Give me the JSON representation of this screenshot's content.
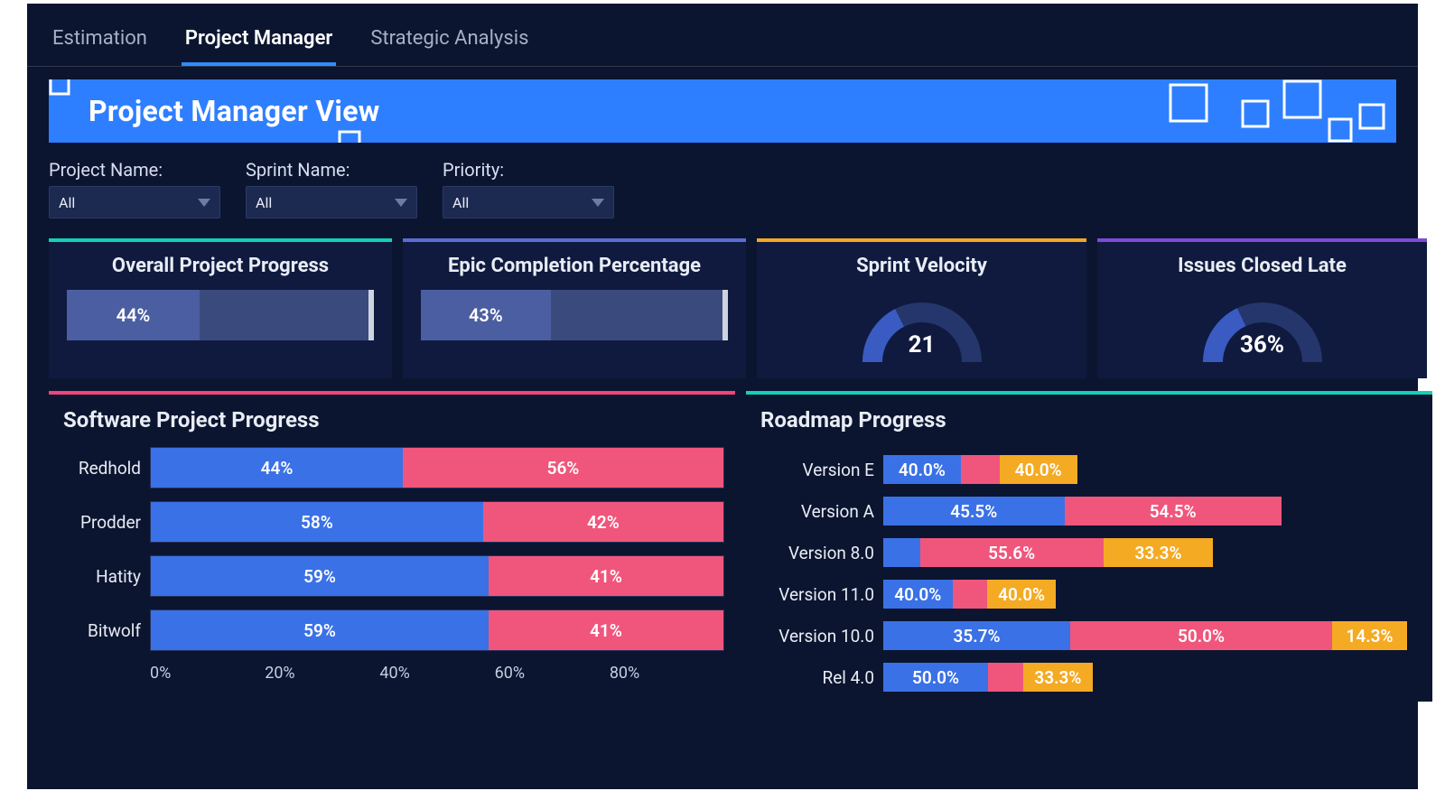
{
  "tabs": [
    {
      "label": "Estimation",
      "active": false
    },
    {
      "label": "Project Manager",
      "active": true
    },
    {
      "label": "Strategic Analysis",
      "active": false
    }
  ],
  "banner": {
    "title": "Project Manager View"
  },
  "filters": {
    "project": {
      "label": "Project Name:",
      "value": "All"
    },
    "sprint": {
      "label": "Sprint Name:",
      "value": "All"
    },
    "priority": {
      "label": "Priority:",
      "value": "All"
    }
  },
  "kpi": {
    "overall": {
      "title": "Overall Project Progress",
      "value": 44,
      "display": "44%"
    },
    "epic": {
      "title": "Epic Completion Percentage",
      "value": 43,
      "display": "43%"
    },
    "velocity": {
      "title": "Sprint Velocity",
      "value": 21,
      "display": "21"
    },
    "late": {
      "title": "Issues Closed Late",
      "value": 36,
      "display": "36%"
    }
  },
  "software": {
    "title": "Software Project Progress",
    "rows": [
      {
        "label": "Redhold",
        "blue": 44,
        "red": 56,
        "bd": "44%",
        "rd": "56%"
      },
      {
        "label": "Prodder",
        "blue": 58,
        "red": 42,
        "bd": "58%",
        "rd": "42%"
      },
      {
        "label": "Hatity",
        "blue": 59,
        "red": 41,
        "bd": "59%",
        "rd": "41%"
      },
      {
        "label": "Bitwolf",
        "blue": 59,
        "red": 41,
        "bd": "59%",
        "rd": "41%"
      }
    ],
    "xticks": [
      "0%",
      "20%",
      "40%",
      "60%",
      "80%"
    ]
  },
  "roadmap": {
    "title": "Roadmap Progress",
    "max": 100,
    "rows": [
      {
        "label": "Version E",
        "blue": 40.0,
        "red": 20.0,
        "yel": 40.0,
        "total_scale": 37,
        "bd": "40.0%",
        "rd": "",
        "yd": "40.0%"
      },
      {
        "label": "Version A",
        "blue": 45.5,
        "red": 54.5,
        "yel": 0,
        "total_scale": 76,
        "bd": "45.5%",
        "rd": "54.5%",
        "yd": ""
      },
      {
        "label": "Version 8.0",
        "blue": 11.1,
        "red": 55.6,
        "yel": 33.3,
        "total_scale": 63,
        "bd": "",
        "rd": "55.6%",
        "yd": "33.3%"
      },
      {
        "label": "Version 11.0",
        "blue": 40.0,
        "red": 20.0,
        "yel": 40.0,
        "total_scale": 33,
        "bd": "40.0%",
        "rd": "",
        "yd": "40.0%"
      },
      {
        "label": "Version 10.0",
        "blue": 35.7,
        "red": 50.0,
        "yel": 14.3,
        "total_scale": 100,
        "bd": "35.7%",
        "rd": "50.0%",
        "yd": "14.3%"
      },
      {
        "label": "Rel 4.0",
        "blue": 50.0,
        "red": 16.7,
        "yel": 33.3,
        "total_scale": 40,
        "bd": "50.0%",
        "rd": "",
        "yd": "33.3%"
      }
    ]
  },
  "chart_data": [
    {
      "type": "bar",
      "title": "Software Project Progress",
      "orientation": "horizontal",
      "stacked_100pct": true,
      "categories": [
        "Redhold",
        "Prodder",
        "Hatity",
        "Bitwolf"
      ],
      "series": [
        {
          "name": "Blue",
          "values": [
            44,
            58,
            59,
            59
          ]
        },
        {
          "name": "Red",
          "values": [
            56,
            42,
            41,
            41
          ]
        }
      ],
      "xlabel": "",
      "ylabel": "",
      "xlim": [
        0,
        100
      ],
      "xticks": [
        0,
        20,
        40,
        60,
        80
      ]
    },
    {
      "type": "bar",
      "title": "Roadmap Progress",
      "orientation": "horizontal",
      "stacked": true,
      "categories": [
        "Version E",
        "Version A",
        "Version 8.0",
        "Version 11.0",
        "Version 10.0",
        "Rel 4.0"
      ],
      "series": [
        {
          "name": "Blue",
          "values": [
            40.0,
            45.5,
            11.1,
            40.0,
            35.7,
            50.0
          ]
        },
        {
          "name": "Red",
          "values": [
            20.0,
            54.5,
            55.6,
            20.0,
            50.0,
            16.7
          ]
        },
        {
          "name": "Yellow",
          "values": [
            40.0,
            0.0,
            33.3,
            40.0,
            14.3,
            33.3
          ]
        }
      ],
      "note": "bar total lengths scaled relative to Version 10.0 = 100"
    },
    {
      "type": "gauge",
      "title": "Overall Project Progress",
      "value": 44,
      "max": 100
    },
    {
      "type": "gauge",
      "title": "Epic Completion Percentage",
      "value": 43,
      "max": 100
    },
    {
      "type": "gauge",
      "title": "Sprint Velocity",
      "value": 21
    },
    {
      "type": "gauge",
      "title": "Issues Closed Late",
      "value": 36,
      "max": 100
    }
  ]
}
